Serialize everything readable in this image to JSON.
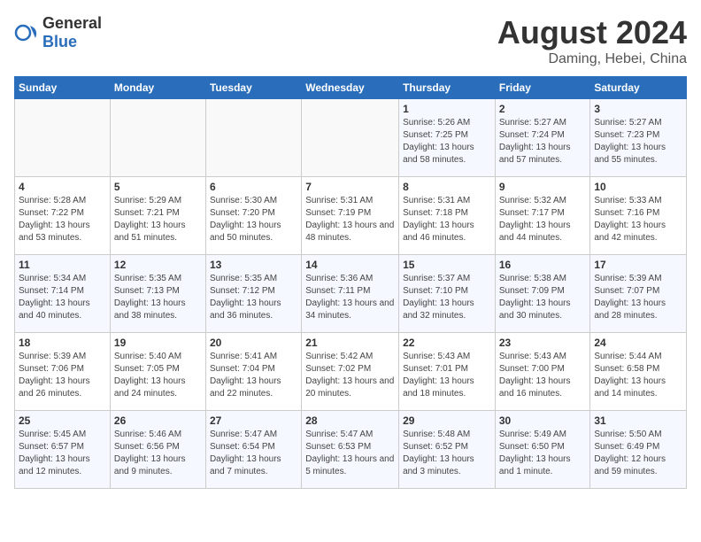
{
  "logo": {
    "general": "General",
    "blue": "Blue"
  },
  "title": "August 2024",
  "location": "Daming, Hebei, China",
  "days_of_week": [
    "Sunday",
    "Monday",
    "Tuesday",
    "Wednesday",
    "Thursday",
    "Friday",
    "Saturday"
  ],
  "weeks": [
    [
      {
        "day": "",
        "sunrise": "",
        "sunset": "",
        "daylight": ""
      },
      {
        "day": "",
        "sunrise": "",
        "sunset": "",
        "daylight": ""
      },
      {
        "day": "",
        "sunrise": "",
        "sunset": "",
        "daylight": ""
      },
      {
        "day": "",
        "sunrise": "",
        "sunset": "",
        "daylight": ""
      },
      {
        "day": "1",
        "sunrise": "Sunrise: 5:26 AM",
        "sunset": "Sunset: 7:25 PM",
        "daylight": "Daylight: 13 hours and 58 minutes."
      },
      {
        "day": "2",
        "sunrise": "Sunrise: 5:27 AM",
        "sunset": "Sunset: 7:24 PM",
        "daylight": "Daylight: 13 hours and 57 minutes."
      },
      {
        "day": "3",
        "sunrise": "Sunrise: 5:27 AM",
        "sunset": "Sunset: 7:23 PM",
        "daylight": "Daylight: 13 hours and 55 minutes."
      }
    ],
    [
      {
        "day": "4",
        "sunrise": "Sunrise: 5:28 AM",
        "sunset": "Sunset: 7:22 PM",
        "daylight": "Daylight: 13 hours and 53 minutes."
      },
      {
        "day": "5",
        "sunrise": "Sunrise: 5:29 AM",
        "sunset": "Sunset: 7:21 PM",
        "daylight": "Daylight: 13 hours and 51 minutes."
      },
      {
        "day": "6",
        "sunrise": "Sunrise: 5:30 AM",
        "sunset": "Sunset: 7:20 PM",
        "daylight": "Daylight: 13 hours and 50 minutes."
      },
      {
        "day": "7",
        "sunrise": "Sunrise: 5:31 AM",
        "sunset": "Sunset: 7:19 PM",
        "daylight": "Daylight: 13 hours and 48 minutes."
      },
      {
        "day": "8",
        "sunrise": "Sunrise: 5:31 AM",
        "sunset": "Sunset: 7:18 PM",
        "daylight": "Daylight: 13 hours and 46 minutes."
      },
      {
        "day": "9",
        "sunrise": "Sunrise: 5:32 AM",
        "sunset": "Sunset: 7:17 PM",
        "daylight": "Daylight: 13 hours and 44 minutes."
      },
      {
        "day": "10",
        "sunrise": "Sunrise: 5:33 AM",
        "sunset": "Sunset: 7:16 PM",
        "daylight": "Daylight: 13 hours and 42 minutes."
      }
    ],
    [
      {
        "day": "11",
        "sunrise": "Sunrise: 5:34 AM",
        "sunset": "Sunset: 7:14 PM",
        "daylight": "Daylight: 13 hours and 40 minutes."
      },
      {
        "day": "12",
        "sunrise": "Sunrise: 5:35 AM",
        "sunset": "Sunset: 7:13 PM",
        "daylight": "Daylight: 13 hours and 38 minutes."
      },
      {
        "day": "13",
        "sunrise": "Sunrise: 5:35 AM",
        "sunset": "Sunset: 7:12 PM",
        "daylight": "Daylight: 13 hours and 36 minutes."
      },
      {
        "day": "14",
        "sunrise": "Sunrise: 5:36 AM",
        "sunset": "Sunset: 7:11 PM",
        "daylight": "Daylight: 13 hours and 34 minutes."
      },
      {
        "day": "15",
        "sunrise": "Sunrise: 5:37 AM",
        "sunset": "Sunset: 7:10 PM",
        "daylight": "Daylight: 13 hours and 32 minutes."
      },
      {
        "day": "16",
        "sunrise": "Sunrise: 5:38 AM",
        "sunset": "Sunset: 7:09 PM",
        "daylight": "Daylight: 13 hours and 30 minutes."
      },
      {
        "day": "17",
        "sunrise": "Sunrise: 5:39 AM",
        "sunset": "Sunset: 7:07 PM",
        "daylight": "Daylight: 13 hours and 28 minutes."
      }
    ],
    [
      {
        "day": "18",
        "sunrise": "Sunrise: 5:39 AM",
        "sunset": "Sunset: 7:06 PM",
        "daylight": "Daylight: 13 hours and 26 minutes."
      },
      {
        "day": "19",
        "sunrise": "Sunrise: 5:40 AM",
        "sunset": "Sunset: 7:05 PM",
        "daylight": "Daylight: 13 hours and 24 minutes."
      },
      {
        "day": "20",
        "sunrise": "Sunrise: 5:41 AM",
        "sunset": "Sunset: 7:04 PM",
        "daylight": "Daylight: 13 hours and 22 minutes."
      },
      {
        "day": "21",
        "sunrise": "Sunrise: 5:42 AM",
        "sunset": "Sunset: 7:02 PM",
        "daylight": "Daylight: 13 hours and 20 minutes."
      },
      {
        "day": "22",
        "sunrise": "Sunrise: 5:43 AM",
        "sunset": "Sunset: 7:01 PM",
        "daylight": "Daylight: 13 hours and 18 minutes."
      },
      {
        "day": "23",
        "sunrise": "Sunrise: 5:43 AM",
        "sunset": "Sunset: 7:00 PM",
        "daylight": "Daylight: 13 hours and 16 minutes."
      },
      {
        "day": "24",
        "sunrise": "Sunrise: 5:44 AM",
        "sunset": "Sunset: 6:58 PM",
        "daylight": "Daylight: 13 hours and 14 minutes."
      }
    ],
    [
      {
        "day": "25",
        "sunrise": "Sunrise: 5:45 AM",
        "sunset": "Sunset: 6:57 PM",
        "daylight": "Daylight: 13 hours and 12 minutes."
      },
      {
        "day": "26",
        "sunrise": "Sunrise: 5:46 AM",
        "sunset": "Sunset: 6:56 PM",
        "daylight": "Daylight: 13 hours and 9 minutes."
      },
      {
        "day": "27",
        "sunrise": "Sunrise: 5:47 AM",
        "sunset": "Sunset: 6:54 PM",
        "daylight": "Daylight: 13 hours and 7 minutes."
      },
      {
        "day": "28",
        "sunrise": "Sunrise: 5:47 AM",
        "sunset": "Sunset: 6:53 PM",
        "daylight": "Daylight: 13 hours and 5 minutes."
      },
      {
        "day": "29",
        "sunrise": "Sunrise: 5:48 AM",
        "sunset": "Sunset: 6:52 PM",
        "daylight": "Daylight: 13 hours and 3 minutes."
      },
      {
        "day": "30",
        "sunrise": "Sunrise: 5:49 AM",
        "sunset": "Sunset: 6:50 PM",
        "daylight": "Daylight: 13 hours and 1 minute."
      },
      {
        "day": "31",
        "sunrise": "Sunrise: 5:50 AM",
        "sunset": "Sunset: 6:49 PM",
        "daylight": "Daylight: 12 hours and 59 minutes."
      }
    ]
  ]
}
